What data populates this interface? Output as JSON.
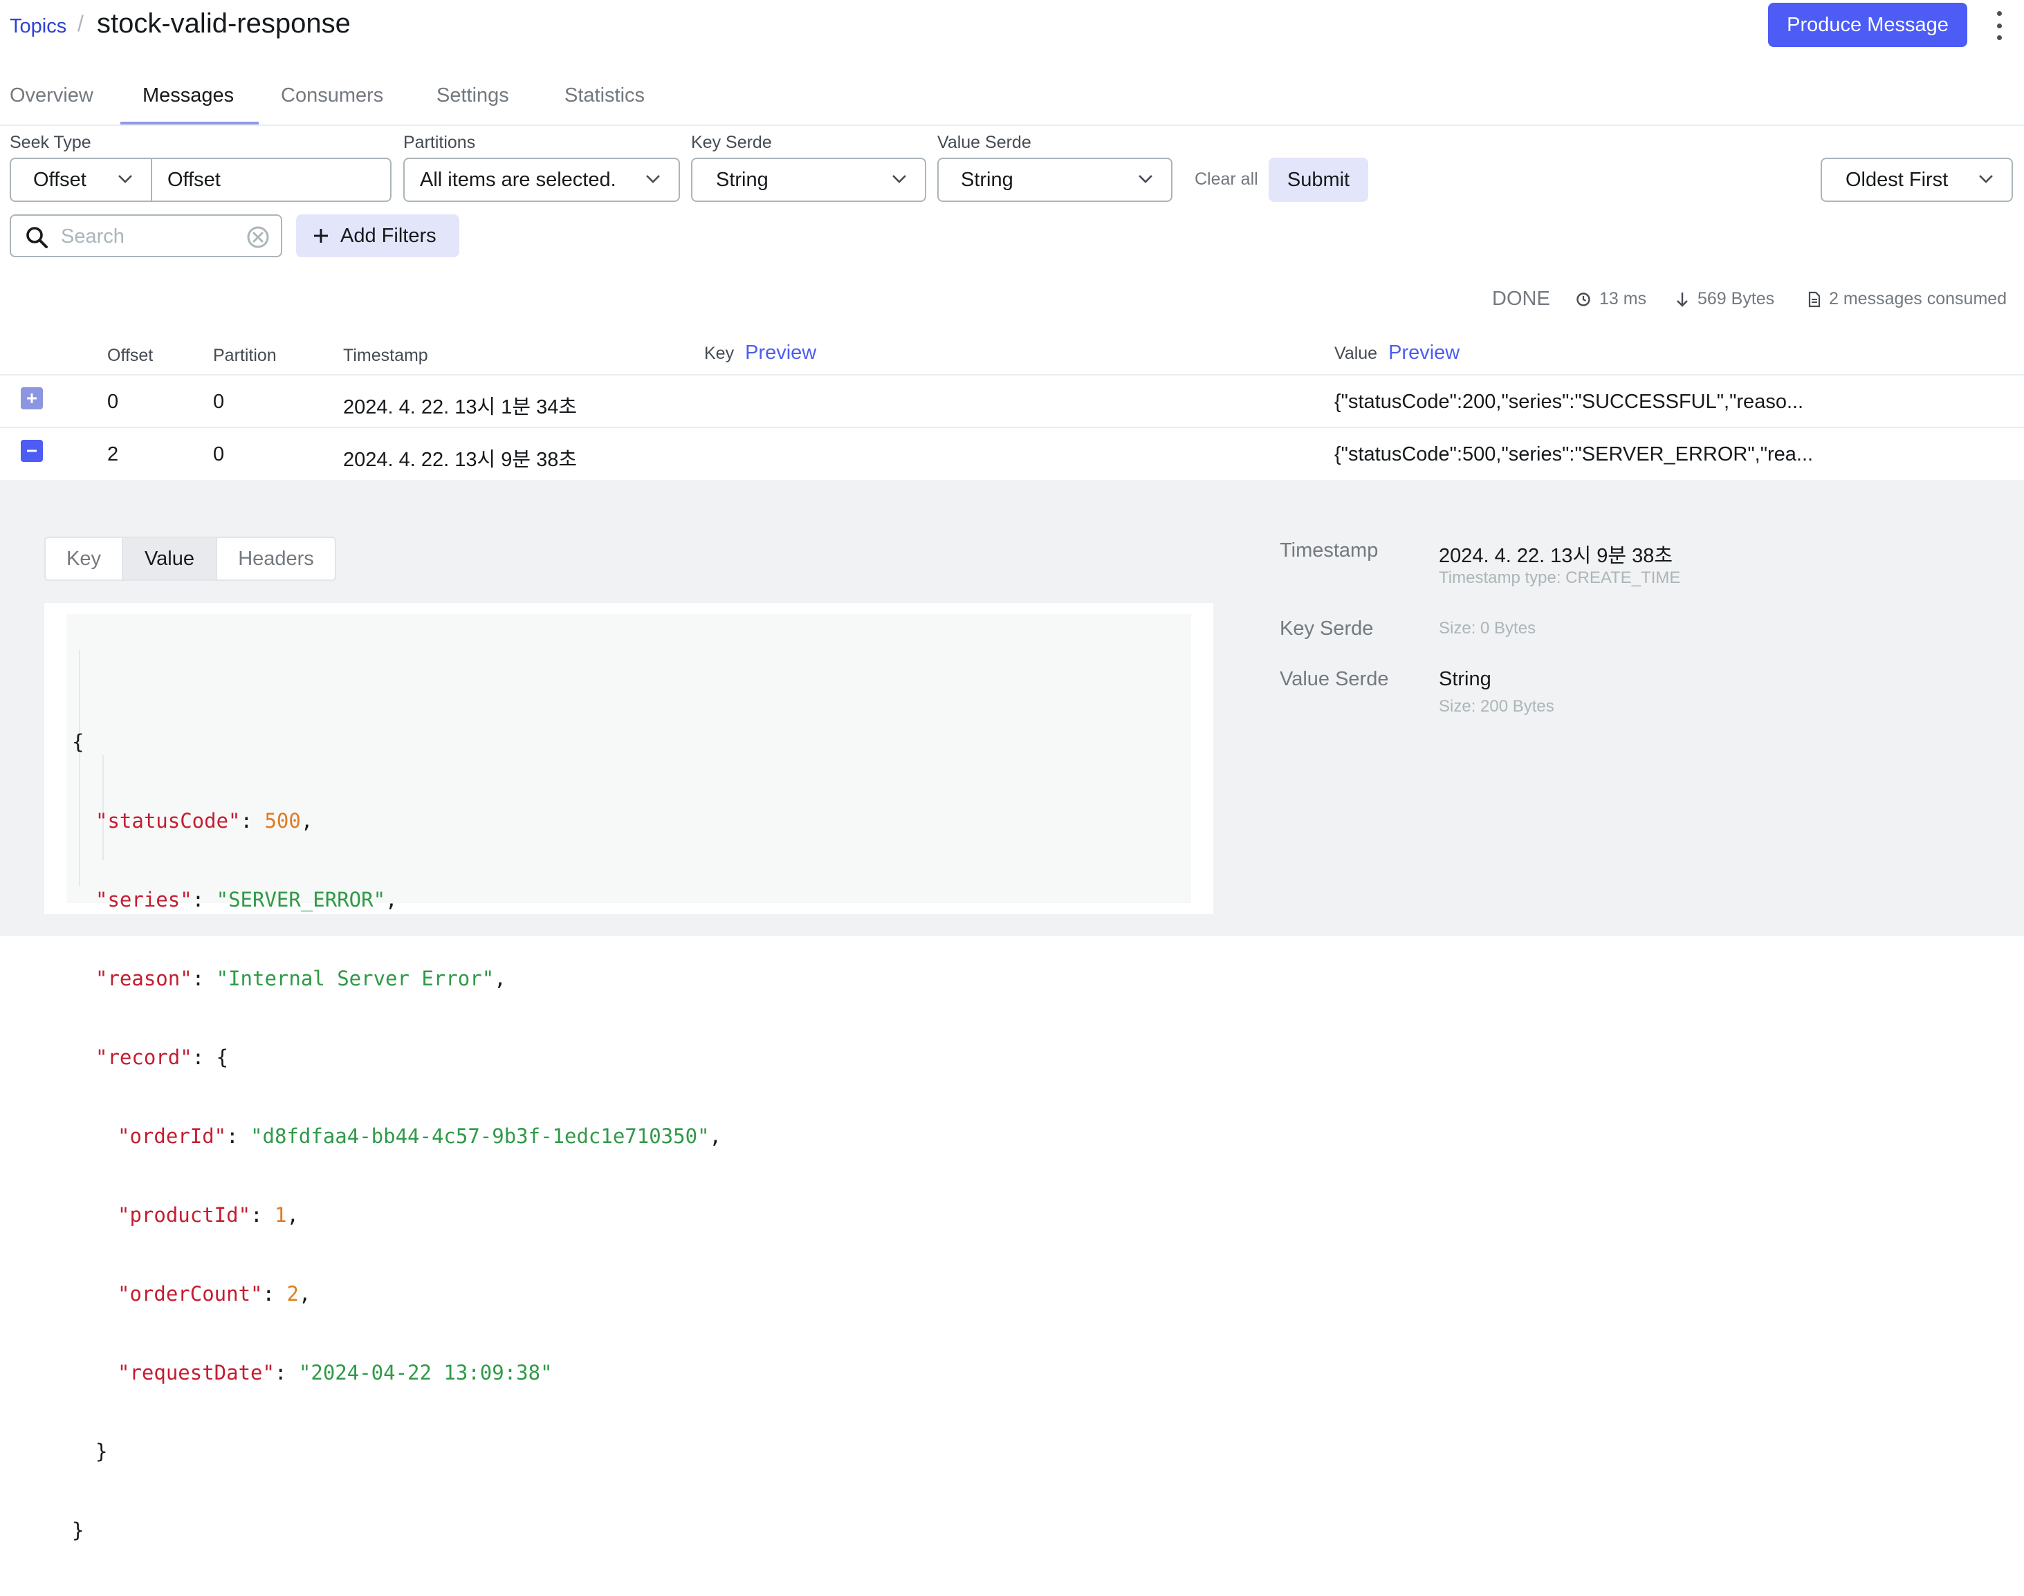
{
  "header": {
    "breadcrumb_link": "Topics",
    "breadcrumb_separator": "/",
    "title": "stock-valid-response",
    "produce_label": "Produce Message"
  },
  "tabs": [
    {
      "label": "Overview",
      "active": false
    },
    {
      "label": "Messages",
      "active": true
    },
    {
      "label": "Consumers",
      "active": false
    },
    {
      "label": "Settings",
      "active": false
    },
    {
      "label": "Statistics",
      "active": false
    }
  ],
  "filters": {
    "seek_type_label": "Seek Type",
    "seek_type_value": "Offset",
    "offset_value": "Offset",
    "partitions_label": "Partitions",
    "partitions_value": "All items are selected.",
    "key_serde_label": "Key Serde",
    "key_serde_value": "String",
    "value_serde_label": "Value Serde",
    "value_serde_value": "String",
    "clear_all_label": "Clear all",
    "submit_label": "Submit",
    "sort_value": "Oldest First",
    "search_placeholder": "Search",
    "add_filters_label": "Add Filters"
  },
  "stats": {
    "status": "DONE",
    "elapsed": "13 ms",
    "bytes": "569 Bytes",
    "messages": "2 messages consumed"
  },
  "table": {
    "columns": {
      "offset": "Offset",
      "partition": "Partition",
      "timestamp": "Timestamp",
      "key": "Key",
      "key_preview": "Preview",
      "value": "Value",
      "value_preview": "Preview"
    },
    "rows": [
      {
        "offset": "0",
        "partition": "0",
        "timestamp": "2024. 4. 22. 13시 1분 34초",
        "value": "{\"statusCode\":200,\"series\":\"SUCCESSFUL\",\"reaso...",
        "expanded": false
      },
      {
        "offset": "2",
        "partition": "0",
        "timestamp": "2024. 4. 22. 13시 9분 38초",
        "value": "{\"statusCode\":500,\"series\":\"SERVER_ERROR\",\"rea...",
        "expanded": true
      }
    ]
  },
  "details": {
    "tabs": [
      "Key",
      "Value",
      "Headers"
    ],
    "active_tab": "Value",
    "json": {
      "open_brace": "{",
      "statusCode_key": "\"statusCode\"",
      "statusCode_val": "500",
      "series_key": "\"series\"",
      "series_val": "\"SERVER_ERROR\"",
      "reason_key": "\"reason\"",
      "reason_val": "\"Internal Server Error\"",
      "record_key": "\"record\"",
      "orderId_key": "\"orderId\"",
      "orderId_val": "\"d8fdfaa4-bb44-4c57-9b3f-1edc1e710350\"",
      "productId_key": "\"productId\"",
      "productId_val": "1",
      "orderCount_key": "\"orderCount\"",
      "orderCount_val": "2",
      "requestDate_key": "\"requestDate\"",
      "requestDate_val": "\"2024-04-22 13:09:38\"",
      "inner_close": "}",
      "close_brace": "}"
    },
    "meta": {
      "timestamp_label": "Timestamp",
      "timestamp_value": "2024. 4. 22. 13시 9분 38초",
      "timestamp_type": "Timestamp type: CREATE_TIME",
      "key_serde_label": "Key Serde",
      "key_size": "Size: 0 Bytes",
      "value_serde_label": "Value Serde",
      "value_serde_value": "String",
      "value_size": "Size: 200 Bytes"
    }
  },
  "colors": {
    "accent": "#4c5cf5",
    "json_key": "#c41d31",
    "json_string": "#2f9a47",
    "json_number": "#e07b20"
  }
}
